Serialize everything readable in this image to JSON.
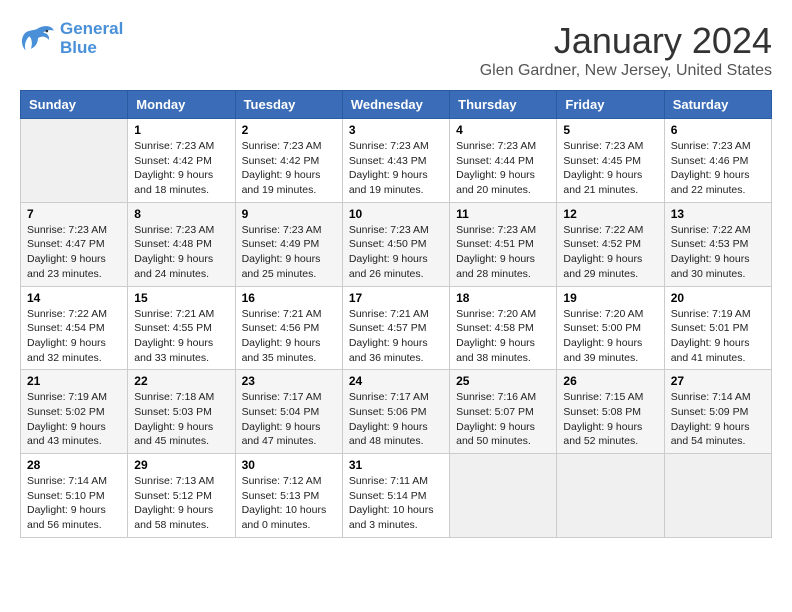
{
  "header": {
    "logo_line1": "General",
    "logo_line2": "Blue",
    "month": "January 2024",
    "location": "Glen Gardner, New Jersey, United States"
  },
  "weekdays": [
    "Sunday",
    "Monday",
    "Tuesday",
    "Wednesday",
    "Thursday",
    "Friday",
    "Saturday"
  ],
  "weeks": [
    [
      {
        "day": "",
        "sunrise": "",
        "sunset": "",
        "daylight": ""
      },
      {
        "day": "1",
        "sunrise": "Sunrise: 7:23 AM",
        "sunset": "Sunset: 4:42 PM",
        "daylight": "Daylight: 9 hours and 18 minutes."
      },
      {
        "day": "2",
        "sunrise": "Sunrise: 7:23 AM",
        "sunset": "Sunset: 4:42 PM",
        "daylight": "Daylight: 9 hours and 19 minutes."
      },
      {
        "day": "3",
        "sunrise": "Sunrise: 7:23 AM",
        "sunset": "Sunset: 4:43 PM",
        "daylight": "Daylight: 9 hours and 19 minutes."
      },
      {
        "day": "4",
        "sunrise": "Sunrise: 7:23 AM",
        "sunset": "Sunset: 4:44 PM",
        "daylight": "Daylight: 9 hours and 20 minutes."
      },
      {
        "day": "5",
        "sunrise": "Sunrise: 7:23 AM",
        "sunset": "Sunset: 4:45 PM",
        "daylight": "Daylight: 9 hours and 21 minutes."
      },
      {
        "day": "6",
        "sunrise": "Sunrise: 7:23 AM",
        "sunset": "Sunset: 4:46 PM",
        "daylight": "Daylight: 9 hours and 22 minutes."
      }
    ],
    [
      {
        "day": "7",
        "sunrise": "Sunrise: 7:23 AM",
        "sunset": "Sunset: 4:47 PM",
        "daylight": "Daylight: 9 hours and 23 minutes."
      },
      {
        "day": "8",
        "sunrise": "Sunrise: 7:23 AM",
        "sunset": "Sunset: 4:48 PM",
        "daylight": "Daylight: 9 hours and 24 minutes."
      },
      {
        "day": "9",
        "sunrise": "Sunrise: 7:23 AM",
        "sunset": "Sunset: 4:49 PM",
        "daylight": "Daylight: 9 hours and 25 minutes."
      },
      {
        "day": "10",
        "sunrise": "Sunrise: 7:23 AM",
        "sunset": "Sunset: 4:50 PM",
        "daylight": "Daylight: 9 hours and 26 minutes."
      },
      {
        "day": "11",
        "sunrise": "Sunrise: 7:23 AM",
        "sunset": "Sunset: 4:51 PM",
        "daylight": "Daylight: 9 hours and 28 minutes."
      },
      {
        "day": "12",
        "sunrise": "Sunrise: 7:22 AM",
        "sunset": "Sunset: 4:52 PM",
        "daylight": "Daylight: 9 hours and 29 minutes."
      },
      {
        "day": "13",
        "sunrise": "Sunrise: 7:22 AM",
        "sunset": "Sunset: 4:53 PM",
        "daylight": "Daylight: 9 hours and 30 minutes."
      }
    ],
    [
      {
        "day": "14",
        "sunrise": "Sunrise: 7:22 AM",
        "sunset": "Sunset: 4:54 PM",
        "daylight": "Daylight: 9 hours and 32 minutes."
      },
      {
        "day": "15",
        "sunrise": "Sunrise: 7:21 AM",
        "sunset": "Sunset: 4:55 PM",
        "daylight": "Daylight: 9 hours and 33 minutes."
      },
      {
        "day": "16",
        "sunrise": "Sunrise: 7:21 AM",
        "sunset": "Sunset: 4:56 PM",
        "daylight": "Daylight: 9 hours and 35 minutes."
      },
      {
        "day": "17",
        "sunrise": "Sunrise: 7:21 AM",
        "sunset": "Sunset: 4:57 PM",
        "daylight": "Daylight: 9 hours and 36 minutes."
      },
      {
        "day": "18",
        "sunrise": "Sunrise: 7:20 AM",
        "sunset": "Sunset: 4:58 PM",
        "daylight": "Daylight: 9 hours and 38 minutes."
      },
      {
        "day": "19",
        "sunrise": "Sunrise: 7:20 AM",
        "sunset": "Sunset: 5:00 PM",
        "daylight": "Daylight: 9 hours and 39 minutes."
      },
      {
        "day": "20",
        "sunrise": "Sunrise: 7:19 AM",
        "sunset": "Sunset: 5:01 PM",
        "daylight": "Daylight: 9 hours and 41 minutes."
      }
    ],
    [
      {
        "day": "21",
        "sunrise": "Sunrise: 7:19 AM",
        "sunset": "Sunset: 5:02 PM",
        "daylight": "Daylight: 9 hours and 43 minutes."
      },
      {
        "day": "22",
        "sunrise": "Sunrise: 7:18 AM",
        "sunset": "Sunset: 5:03 PM",
        "daylight": "Daylight: 9 hours and 45 minutes."
      },
      {
        "day": "23",
        "sunrise": "Sunrise: 7:17 AM",
        "sunset": "Sunset: 5:04 PM",
        "daylight": "Daylight: 9 hours and 47 minutes."
      },
      {
        "day": "24",
        "sunrise": "Sunrise: 7:17 AM",
        "sunset": "Sunset: 5:06 PM",
        "daylight": "Daylight: 9 hours and 48 minutes."
      },
      {
        "day": "25",
        "sunrise": "Sunrise: 7:16 AM",
        "sunset": "Sunset: 5:07 PM",
        "daylight": "Daylight: 9 hours and 50 minutes."
      },
      {
        "day": "26",
        "sunrise": "Sunrise: 7:15 AM",
        "sunset": "Sunset: 5:08 PM",
        "daylight": "Daylight: 9 hours and 52 minutes."
      },
      {
        "day": "27",
        "sunrise": "Sunrise: 7:14 AM",
        "sunset": "Sunset: 5:09 PM",
        "daylight": "Daylight: 9 hours and 54 minutes."
      }
    ],
    [
      {
        "day": "28",
        "sunrise": "Sunrise: 7:14 AM",
        "sunset": "Sunset: 5:10 PM",
        "daylight": "Daylight: 9 hours and 56 minutes."
      },
      {
        "day": "29",
        "sunrise": "Sunrise: 7:13 AM",
        "sunset": "Sunset: 5:12 PM",
        "daylight": "Daylight: 9 hours and 58 minutes."
      },
      {
        "day": "30",
        "sunrise": "Sunrise: 7:12 AM",
        "sunset": "Sunset: 5:13 PM",
        "daylight": "Daylight: 10 hours and 0 minutes."
      },
      {
        "day": "31",
        "sunrise": "Sunrise: 7:11 AM",
        "sunset": "Sunset: 5:14 PM",
        "daylight": "Daylight: 10 hours and 3 minutes."
      },
      {
        "day": "",
        "sunrise": "",
        "sunset": "",
        "daylight": ""
      },
      {
        "day": "",
        "sunrise": "",
        "sunset": "",
        "daylight": ""
      },
      {
        "day": "",
        "sunrise": "",
        "sunset": "",
        "daylight": ""
      }
    ]
  ]
}
